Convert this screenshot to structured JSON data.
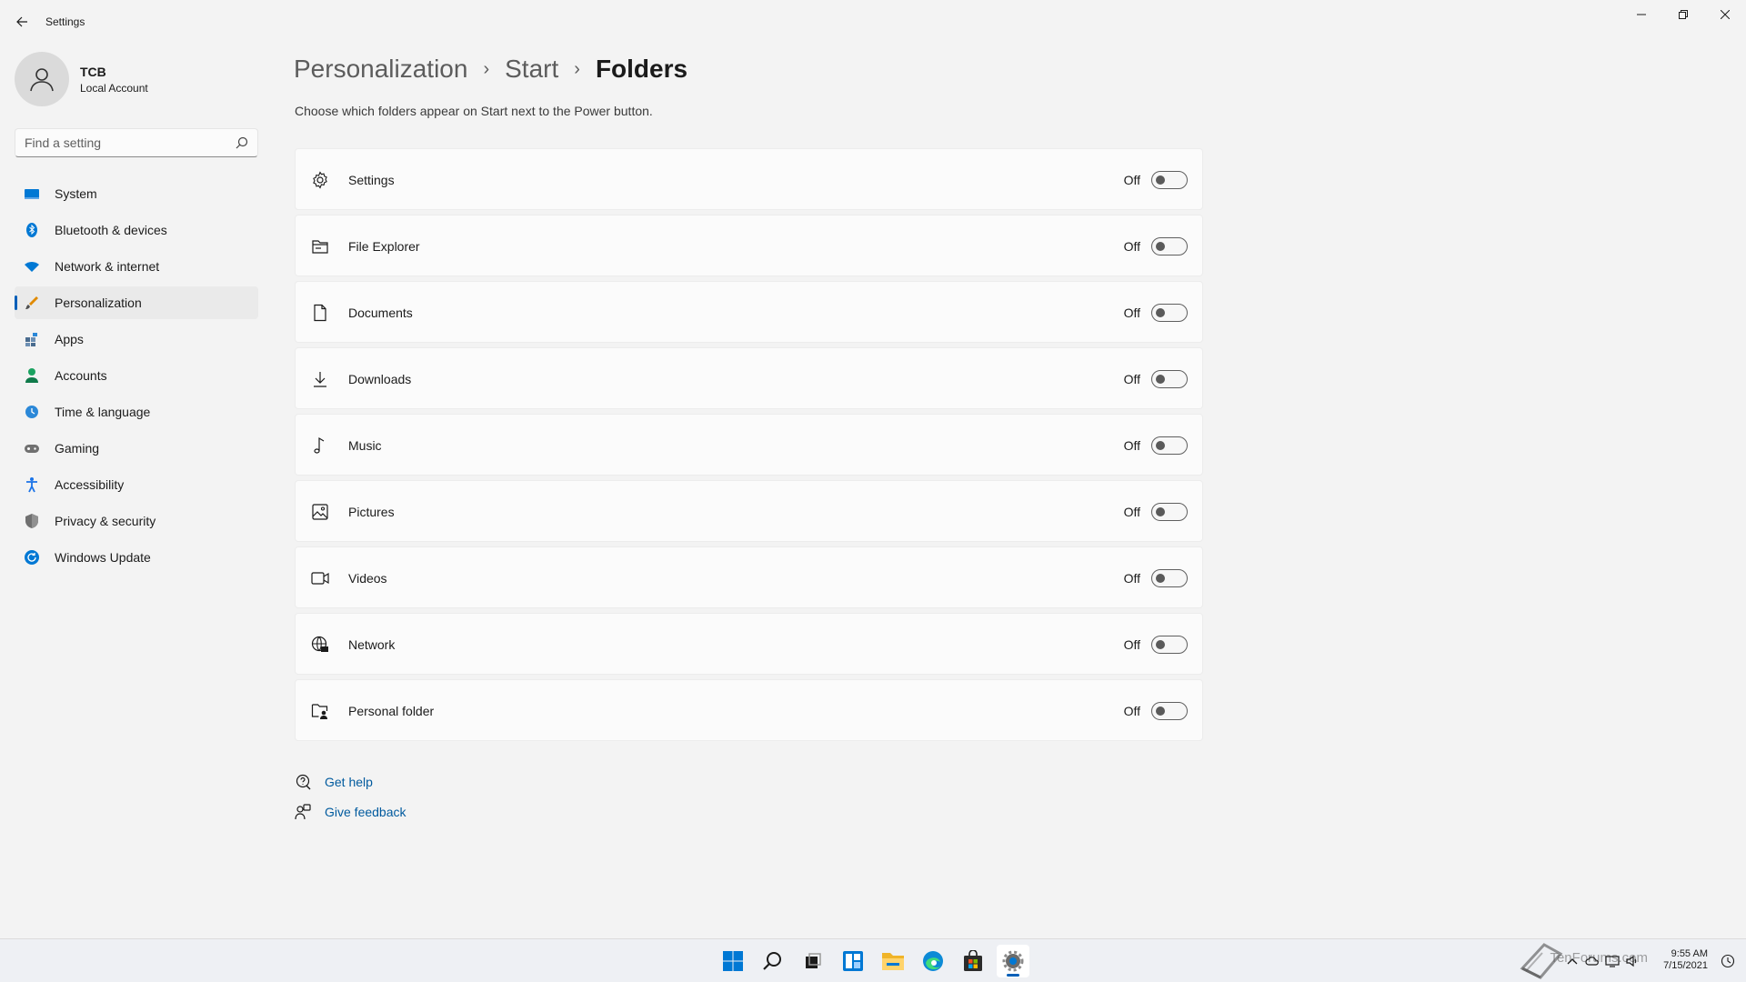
{
  "window": {
    "title": "Settings",
    "controls": [
      "minimize",
      "restore",
      "close"
    ]
  },
  "profile": {
    "name": "TCB",
    "account_type": "Local Account"
  },
  "search": {
    "placeholder": "Find a setting"
  },
  "nav": {
    "items": [
      {
        "label": "System",
        "icon": "system-icon",
        "color": "#0078d4"
      },
      {
        "label": "Bluetooth & devices",
        "icon": "bluetooth-icon",
        "color": "#0078d4"
      },
      {
        "label": "Network & internet",
        "icon": "wifi-icon",
        "color": "#0078d4"
      },
      {
        "label": "Personalization",
        "icon": "brush-icon",
        "color": "#e08a00",
        "active": true
      },
      {
        "label": "Apps",
        "icon": "apps-icon",
        "color": "#4a6c8f"
      },
      {
        "label": "Accounts",
        "icon": "accounts-icon",
        "color": "#1aa260"
      },
      {
        "label": "Time & language",
        "icon": "time-language-icon",
        "color": "#2b88d8"
      },
      {
        "label": "Gaming",
        "icon": "gaming-icon",
        "color": "#707070"
      },
      {
        "label": "Accessibility",
        "icon": "accessibility-icon",
        "color": "#1a73e8"
      },
      {
        "label": "Privacy & security",
        "icon": "shield-icon",
        "color": "#707070"
      },
      {
        "label": "Windows Update",
        "icon": "update-icon",
        "color": "#0078d4"
      }
    ]
  },
  "breadcrumb": {
    "items": [
      "Personalization",
      "Start",
      "Folders"
    ],
    "separator": "›"
  },
  "description": "Choose which folders appear on Start next to the Power button.",
  "folders": [
    {
      "label": "Settings",
      "icon": "gear-icon",
      "state": "Off",
      "on": false
    },
    {
      "label": "File Explorer",
      "icon": "file-explorer-icon",
      "state": "Off",
      "on": false
    },
    {
      "label": "Documents",
      "icon": "document-icon",
      "state": "Off",
      "on": false
    },
    {
      "label": "Downloads",
      "icon": "download-icon",
      "state": "Off",
      "on": false
    },
    {
      "label": "Music",
      "icon": "music-icon",
      "state": "Off",
      "on": false
    },
    {
      "label": "Pictures",
      "icon": "picture-icon",
      "state": "Off",
      "on": false
    },
    {
      "label": "Videos",
      "icon": "video-icon",
      "state": "Off",
      "on": false
    },
    {
      "label": "Network",
      "icon": "network-icon",
      "state": "Off",
      "on": false
    },
    {
      "label": "Personal folder",
      "icon": "personal-folder-icon",
      "state": "Off",
      "on": false
    }
  ],
  "help": {
    "get_help": "Get help",
    "give_feedback": "Give feedback"
  },
  "taskbar": {
    "apps": [
      "start-icon",
      "search-icon",
      "task-view-icon",
      "widgets-icon",
      "file-explorer-icon",
      "edge-icon",
      "store-icon",
      "settings-icon"
    ],
    "active_app": "settings-icon",
    "watermark": "TenForums.com",
    "time": "9:55 AM",
    "date": "7/15/2021"
  },
  "colors": {
    "accent": "#005fb8",
    "link": "#005a9e",
    "background": "#f3f3f3",
    "card": "#fbfbfb"
  }
}
